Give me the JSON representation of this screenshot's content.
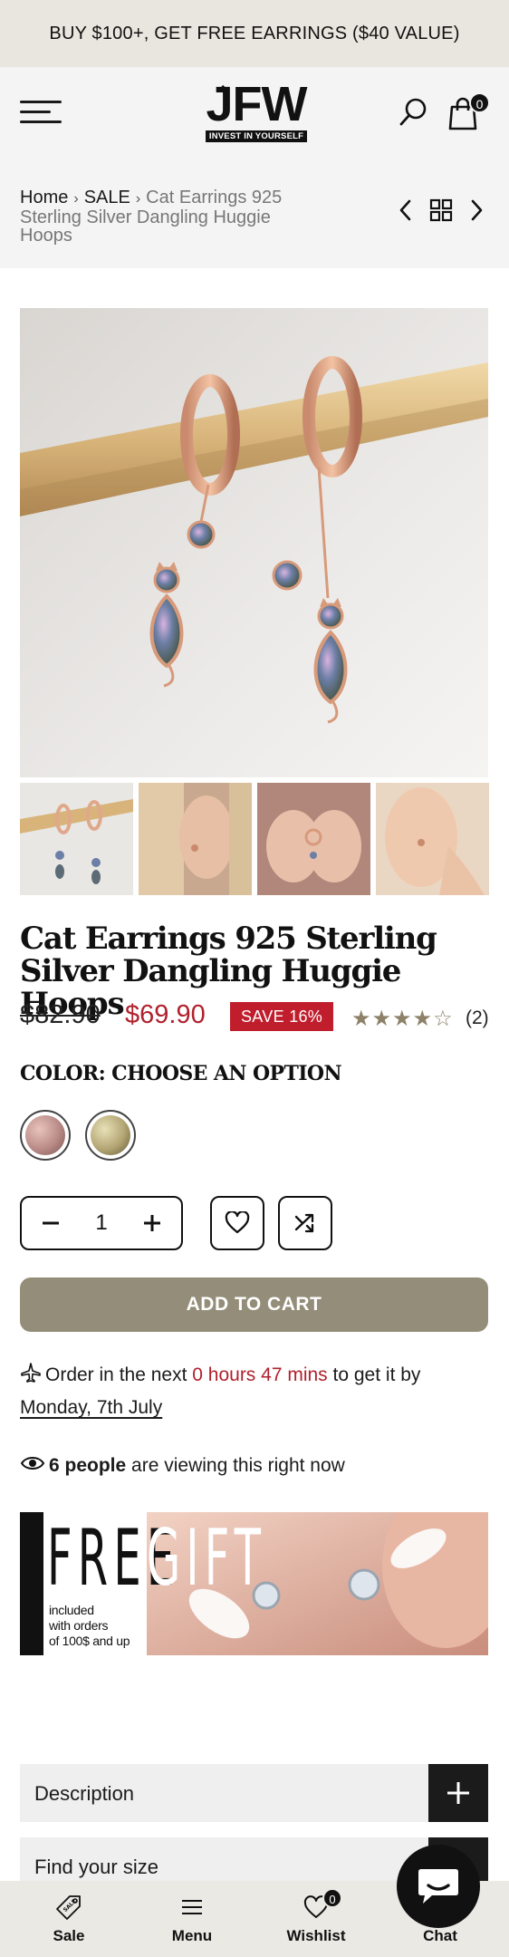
{
  "announcement": "BUY $100+, GET FREE EARRINGS ($40 VALUE)",
  "header": {
    "logo_mark": "JFW",
    "logo_tagline": "INVEST IN YOURSELF",
    "cart_count": "0"
  },
  "breadcrumb": {
    "items": [
      "Home",
      "SALE",
      "Cat Earrings 925 Sterling Silver Dangling Huggie Hoops"
    ]
  },
  "product": {
    "title": "Cat Earrings 925 Sterling Silver Dangling Huggie Hoops",
    "old_price": "$82.90",
    "price": "$69.90",
    "save_badge": "SAVE 16%",
    "rating": 4,
    "rating_max": 5,
    "review_count": "(2)",
    "color_label": "COLOR: CHOOSE AN OPTION",
    "swatches": [
      {
        "name": "rose-gold",
        "color": "#b98a86"
      },
      {
        "name": "gold",
        "color": "#b3a573"
      }
    ],
    "quantity": "1",
    "add_to_cart": "ADD TO CART"
  },
  "delivery": {
    "prefix": "Order in the next",
    "time": "0 hours 47 mins",
    "middle": "to get it by",
    "date": "Monday, 7th July"
  },
  "viewing": {
    "count": "6 people",
    "suffix": "are viewing this right now"
  },
  "gift_banner": {
    "word1": "FREE",
    "word2": "GIFT",
    "lines": [
      "included",
      "with orders",
      "of 100$ and up"
    ]
  },
  "accordions": [
    {
      "label": "Description"
    },
    {
      "label": "Find your size"
    }
  ],
  "bottom_nav": {
    "items": [
      {
        "label": "Sale",
        "icon": "sale-tag-icon"
      },
      {
        "label": "Menu",
        "icon": "menu-icon"
      },
      {
        "label": "Wishlist",
        "icon": "heart-icon"
      },
      {
        "label": "Chat",
        "icon": "chat-icon"
      }
    ],
    "wishlist_count": "0"
  },
  "colors": {
    "accent_red": "#b0212d",
    "add_to_cart_bg": "#948d79",
    "announcement_bg": "#e9e6df",
    "star": "#8d8168"
  }
}
